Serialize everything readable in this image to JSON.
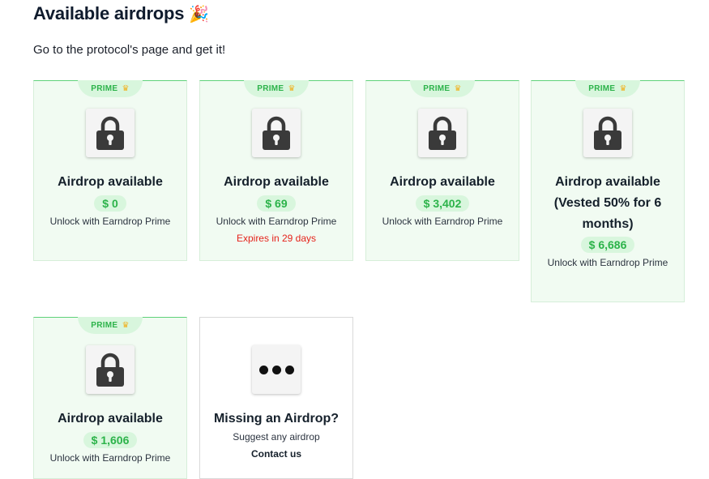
{
  "page": {
    "title": "Available airdrops",
    "title_emoji": "🎉",
    "subtitle": "Go to the protocol's page and get it!"
  },
  "colors": {
    "prime_green": "#2cb34a",
    "card_bg": "#f1fbf2",
    "badge_bg": "#d8f6dd",
    "expires_red": "#e5231b"
  },
  "cards": [
    {
      "tag": "PRIME",
      "icon": "lock-icon",
      "title": "Airdrop available",
      "amount": "$ 0",
      "unlock": "Unlock with Earndrop Prime"
    },
    {
      "tag": "PRIME",
      "icon": "lock-icon",
      "title": "Airdrop available",
      "amount": "$ 69",
      "unlock": "Unlock with Earndrop Prime",
      "expires": "Expires in 29 days"
    },
    {
      "tag": "PRIME",
      "icon": "lock-icon",
      "title": "Airdrop available",
      "amount": "$ 3,402",
      "unlock": "Unlock with Earndrop Prime"
    },
    {
      "tag": "PRIME",
      "icon": "lock-icon",
      "title": "Airdrop available (Vested 50% for 6 months)",
      "amount": "$ 6,686",
      "unlock": "Unlock with Earndrop Prime"
    },
    {
      "tag": "PRIME",
      "icon": "lock-icon",
      "title": "Airdrop available",
      "amount": "$ 1,606",
      "unlock": "Unlock with Earndrop Prime"
    }
  ],
  "missing": {
    "icon": "more-dots-icon",
    "title": "Missing an Airdrop?",
    "suggest": "Suggest any airdrop",
    "contact": "Contact us"
  }
}
